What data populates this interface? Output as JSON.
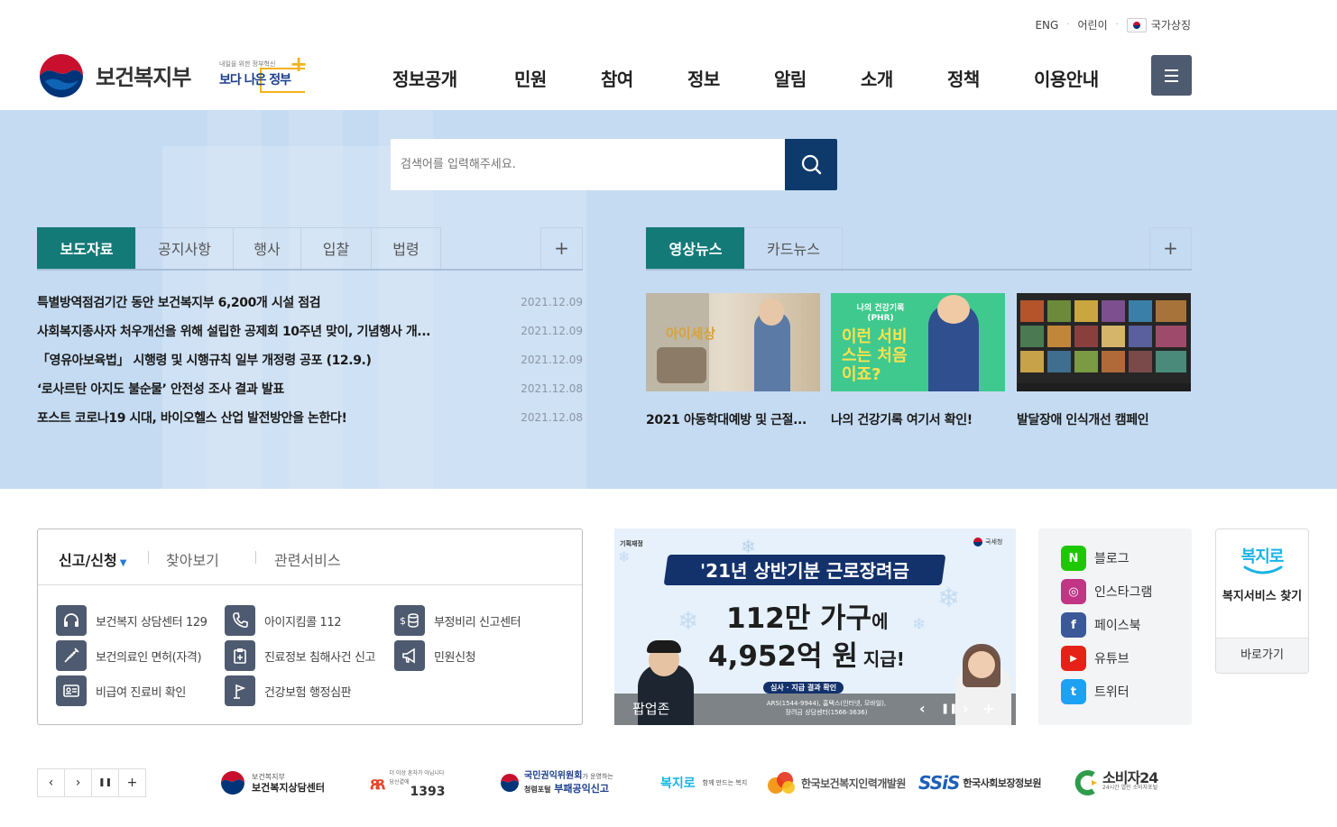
{
  "header": {
    "util": {
      "eng": "ENG",
      "kids": "어린이",
      "symbol": "국가상징"
    },
    "logo_text": "보건복지부",
    "slogan_small": "내일을 위한 정부혁신",
    "slogan_main": "보다 나은 정부",
    "gnb": [
      "정보공개",
      "민원",
      "참여",
      "정보",
      "알림",
      "소개",
      "정책",
      "이용안내"
    ]
  },
  "search": {
    "placeholder": "검색어를 입력해주세요."
  },
  "news": {
    "tabs": [
      "보도자료",
      "공지사항",
      "행사",
      "입찰",
      "법령"
    ],
    "more": "+",
    "items": [
      {
        "title": "특별방역점검기간 동안 보건복지부 6,200개 시설 점검",
        "date": "2021.12.09"
      },
      {
        "title": "사회복지종사자 처우개선을 위해 설립한 공제회 10주년 맞이, 기념행사 개...",
        "date": "2021.12.09"
      },
      {
        "title": "「영유아보육법」 시행령 및 시행규칙 일부 개정령 공포 (12.9.)",
        "date": "2021.12.09"
      },
      {
        "title": "‘로사르탄 아지도 불순물’ 안전성 조사 결과 발표",
        "date": "2021.12.08"
      },
      {
        "title": "포스트 코로나19 시대, 바이오헬스 산업 발전방안을 논한다!",
        "date": "2021.12.08"
      }
    ]
  },
  "media": {
    "tabs": [
      "영상뉴스",
      "카드뉴스"
    ],
    "more": "+",
    "items": [
      {
        "caption": "2021 아동학대예방 및 근절...",
        "thumb_text": "아이세상"
      },
      {
        "caption": "나의 건강기록 여기서 확인!",
        "thumb_small": "나의 건강기록 (PHR)",
        "thumb_text": "이런 서비스는 처음이죠?"
      },
      {
        "caption": "발달장애 인식개선 캠페인"
      }
    ]
  },
  "services": {
    "tabs": [
      "신고/신청",
      "찾아보기",
      "관련서비스"
    ],
    "items": [
      {
        "label": "보건복지 상담센터 129",
        "icon": "headset-icon"
      },
      {
        "label": "아이지킴콜 112",
        "icon": "phone-icon"
      },
      {
        "label": "부정비리 신고센터",
        "icon": "money-icon"
      },
      {
        "label": "보건의료인 면허(자격)",
        "icon": "syringe-icon"
      },
      {
        "label": "진료정보 침해사건 신고",
        "icon": "clipboard-plus-icon"
      },
      {
        "label": "민원신청",
        "icon": "megaphone-icon"
      },
      {
        "label": "비급여 진료비 확인",
        "icon": "id-card-icon"
      },
      {
        "label": "건강보험 행정심판",
        "icon": "flag-icon"
      }
    ]
  },
  "banner": {
    "top_left": "기획재정",
    "top_right": "국세청",
    "title": "'21년 상반기분 근로장려금",
    "line1_big": "112만 가구",
    "line1_small": "에",
    "line2_big": "4,952억 원",
    "line2_small": "지급!",
    "pill": "심사 · 지급 결과 확인",
    "contact1": "ARS(1544-9944), 홈택스(인터넷, 모바일),",
    "contact2": "장려금 상담센터(1566-3636)",
    "zone_label": "팝업존"
  },
  "sns": [
    {
      "label": "블로그",
      "glyph": "N",
      "color": "#1ec800"
    },
    {
      "label": "인스타그램",
      "glyph": "◎",
      "color": "#c13584"
    },
    {
      "label": "페이스북",
      "glyph": "f",
      "color": "#3b5998"
    },
    {
      "label": "유튜브",
      "glyph": "▶",
      "color": "#e62117"
    },
    {
      "label": "트위터",
      "glyph": "t",
      "color": "#1da1f2"
    }
  ],
  "bokji": {
    "logo": "복지로",
    "title": "복지서비스 찾기",
    "button": "바로가기"
  },
  "footer_banners": {
    "controls": [
      "‹",
      "›",
      "❚❚",
      "+"
    ],
    "mohw_small": "보건복지부",
    "mohw_main": "보건복지상담센터",
    "child_small": "더 이상 혼자가 아닙니다 당신곁에",
    "child_main": "1393",
    "acrc_main": "국민권익위원회",
    "acrc_tail": "가 운영하는",
    "acrc_sub1": "청렴포털",
    "acrc_sub2": "부패공익신고",
    "bokjiro": "복지로",
    "bokjiro_sub": "함께 만드는 복지",
    "khdi": "한국보건복지인력개발원",
    "ssis_logo": "SSiS",
    "ssis": "한국사회보장정보원",
    "consumer": "소비자24",
    "consumer_sub": "24시간 열린 소비자포털"
  }
}
